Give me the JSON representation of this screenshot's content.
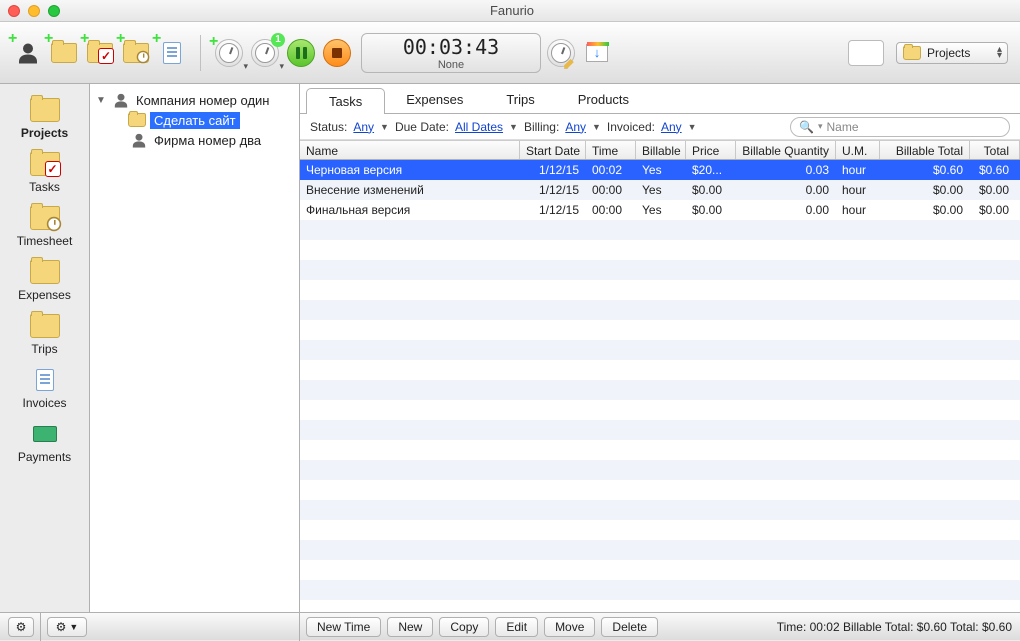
{
  "app": {
    "title": "Fanurio"
  },
  "timer": {
    "display": "00:03:43",
    "subtitle": "None"
  },
  "view_selector": {
    "label": "Projects"
  },
  "sidebar": {
    "items": [
      {
        "key": "projects",
        "label": "Projects",
        "active": true
      },
      {
        "key": "tasks",
        "label": "Tasks"
      },
      {
        "key": "timesheet",
        "label": "Timesheet"
      },
      {
        "key": "expenses",
        "label": "Expenses"
      },
      {
        "key": "trips",
        "label": "Trips"
      },
      {
        "key": "invoices",
        "label": "Invoices"
      },
      {
        "key": "payments",
        "label": "Payments"
      }
    ]
  },
  "timer_badge": "1",
  "tree": {
    "company1": "Компания номер один",
    "selected_project": "Сделать сайт",
    "company2": "Фирма номер два"
  },
  "tabs": [
    {
      "label": "Tasks",
      "active": true
    },
    {
      "label": "Expenses"
    },
    {
      "label": "Trips"
    },
    {
      "label": "Products"
    }
  ],
  "filters": {
    "status_label": "Status:",
    "status_value": "Any",
    "due_label": "Due Date:",
    "due_value": "All Dates",
    "billing_label": "Billing:",
    "billing_value": "Any",
    "invoiced_label": "Invoiced:",
    "invoiced_value": "Any",
    "search_placeholder": "Name"
  },
  "table": {
    "headers": {
      "name": "Name",
      "start": "Start Date",
      "time": "Time",
      "billable": "Billable",
      "price": "Price",
      "bq": "Billable Quantity",
      "um": "U.M.",
      "bt": "Billable Total",
      "total": "Total"
    },
    "rows": [
      {
        "name": "Черновая версия",
        "start": "1/12/15",
        "time": "00:02",
        "billable": "Yes",
        "price": "$20...",
        "bq": "0.03",
        "um": "hour",
        "bt": "$0.60",
        "total": "$0.60",
        "selected": true
      },
      {
        "name": "Внесение изменений",
        "start": "1/12/15",
        "time": "00:00",
        "billable": "Yes",
        "price": "$0.00",
        "bq": "0.00",
        "um": "hour",
        "bt": "$0.00",
        "total": "$0.00"
      },
      {
        "name": "Финальная версия",
        "start": "1/12/15",
        "time": "00:00",
        "billable": "Yes",
        "price": "$0.00",
        "bq": "0.00",
        "um": "hour",
        "bt": "$0.00",
        "total": "$0.00"
      }
    ]
  },
  "bottom_buttons": {
    "new_time": "New Time",
    "new": "New",
    "copy": "Copy",
    "edit": "Edit",
    "move": "Move",
    "delete": "Delete"
  },
  "status_line": "Time: 00:02 Billable Total: $0.60 Total: $0.60"
}
